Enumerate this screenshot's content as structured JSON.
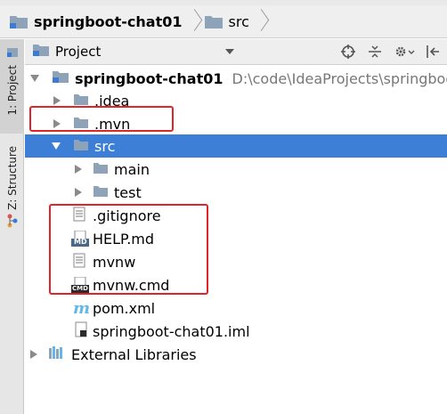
{
  "breadcrumb": [
    {
      "label": "springboot-chat01",
      "icon": "project-folder-icon",
      "bold": true
    },
    {
      "label": "src",
      "icon": "folder-icon",
      "bold": false
    }
  ],
  "tool_tabs": [
    {
      "label": "1: Project",
      "icon": "project-tab-icon",
      "active": true
    },
    {
      "label": "Z: Structure",
      "icon": "structure-tab-icon",
      "active": false
    }
  ],
  "project_panel": {
    "title": "Project",
    "icons": [
      "target-icon",
      "collapse-all-icon",
      "gear-icon",
      "hide-icon"
    ]
  },
  "tree": {
    "root": {
      "label": "springboot-chat01",
      "path": "D:\\code\\IdeaProjects\\springboot"
    },
    "items": [
      {
        "label": ".idea"
      },
      {
        "label": ".mvn"
      },
      {
        "label": "src"
      },
      {
        "label": "main"
      },
      {
        "label": "test"
      },
      {
        "label": ".gitignore"
      },
      {
        "label": "HELP.md"
      },
      {
        "label": "mvnw"
      },
      {
        "label": "mvnw.cmd"
      },
      {
        "label": "pom.xml"
      },
      {
        "label": "springboot-chat01.iml"
      },
      {
        "label": "External Libraries"
      }
    ]
  },
  "colors": {
    "selection": "#3d7fd6",
    "highlight_box": "#e0252a",
    "folder": "#8fa3b8",
    "maven": "#62b6e8"
  },
  "icon_text": {
    "md": "MD",
    "cmd": "CMD",
    "maven": "m"
  }
}
